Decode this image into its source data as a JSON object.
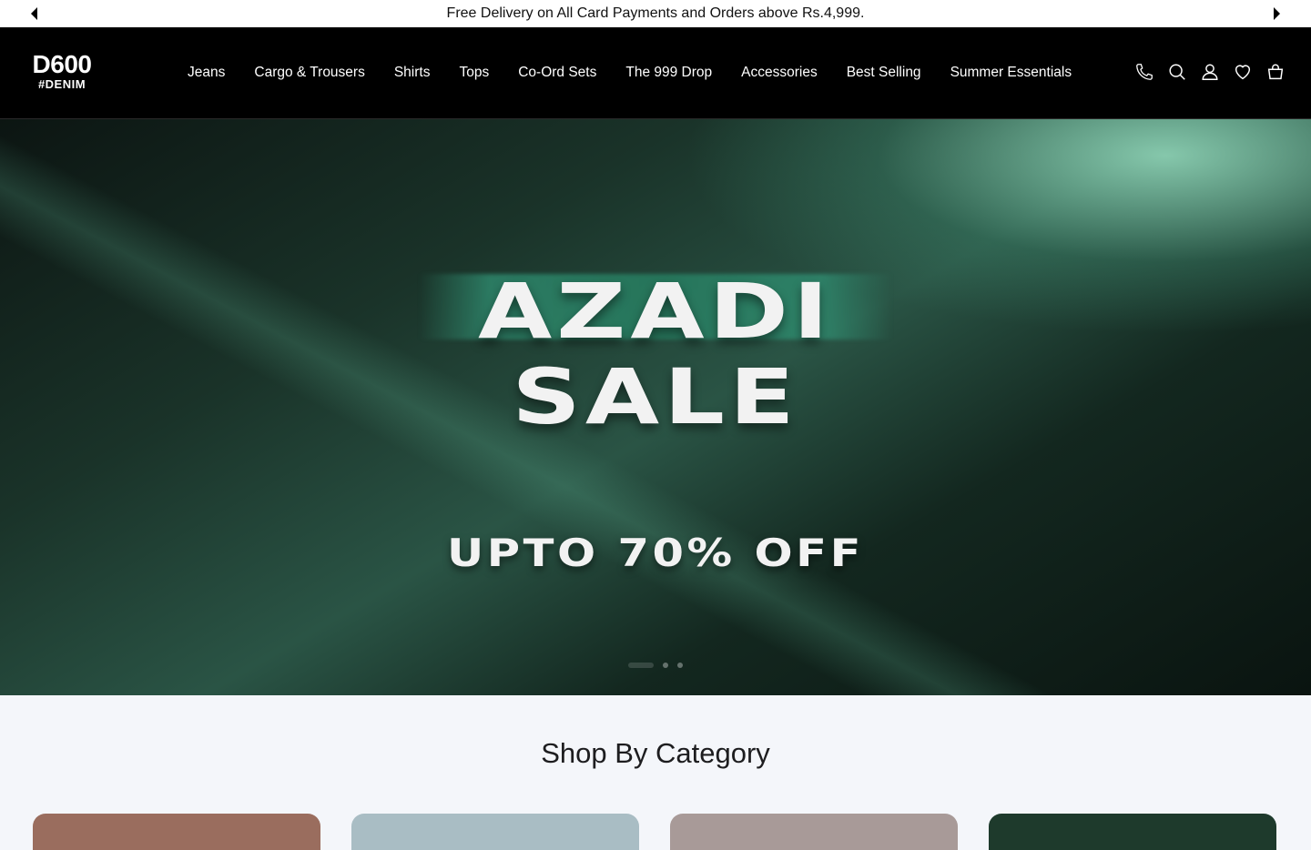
{
  "announcement": {
    "text": "Free Delivery on All Card Payments and Orders above Rs.4,999.",
    "prev_icon": "caret-left",
    "next_icon": "caret-right"
  },
  "header": {
    "logo_main": "D600",
    "logo_sub": "#DENIM",
    "nav": [
      "Jeans",
      "Cargo & Trousers",
      "Shirts",
      "Tops",
      "Co-Ord Sets",
      "The 999 Drop",
      "Accessories",
      "Best Selling",
      "Summer Essentials"
    ],
    "icons": [
      "phone-icon",
      "search-icon",
      "user-icon",
      "heart-icon",
      "cart-icon"
    ]
  },
  "hero": {
    "line1": "AZADI",
    "line2": "SALE",
    "line3": "UPTO 70% OFF",
    "slides": 3,
    "active_slide": 1
  },
  "category": {
    "title": "Shop By Category",
    "card_colors": [
      "#9a6d5e",
      "#a9bdc4",
      "#a89a98",
      "#1e3a2c"
    ]
  },
  "colors": {
    "header_bg": "#000000",
    "hero_accent": "#2a5445"
  }
}
